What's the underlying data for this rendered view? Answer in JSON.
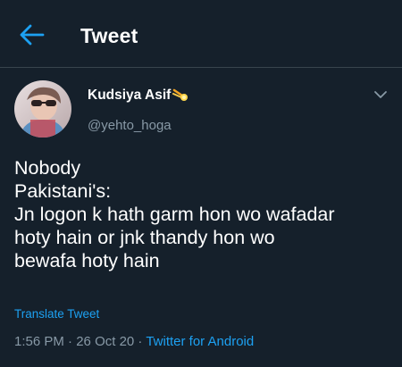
{
  "header": {
    "title": "Tweet",
    "back_icon": "arrow-left-icon",
    "accent_color": "#1da1f2"
  },
  "author": {
    "display_name": "Kudsiya Asif",
    "badge_icon": "comet-emoji-icon",
    "handle": "@yehto_hoga"
  },
  "tweet": {
    "lines": [
      "Nobody",
      "Pakistani's:",
      "Jn logon k hath garm hon wo wafadar",
      "hoty hain or jnk thandy hon wo",
      "bewafa hoty hain"
    ],
    "translate_label": "Translate Tweet",
    "time": "1:56 PM",
    "date": "26 Oct 20",
    "source": "Twitter for Android",
    "separator": " · "
  },
  "colors": {
    "background": "#15202b",
    "text_primary": "#ffffff",
    "text_secondary": "#8899a6",
    "divider": "#38444d",
    "link": "#1da1f2"
  }
}
